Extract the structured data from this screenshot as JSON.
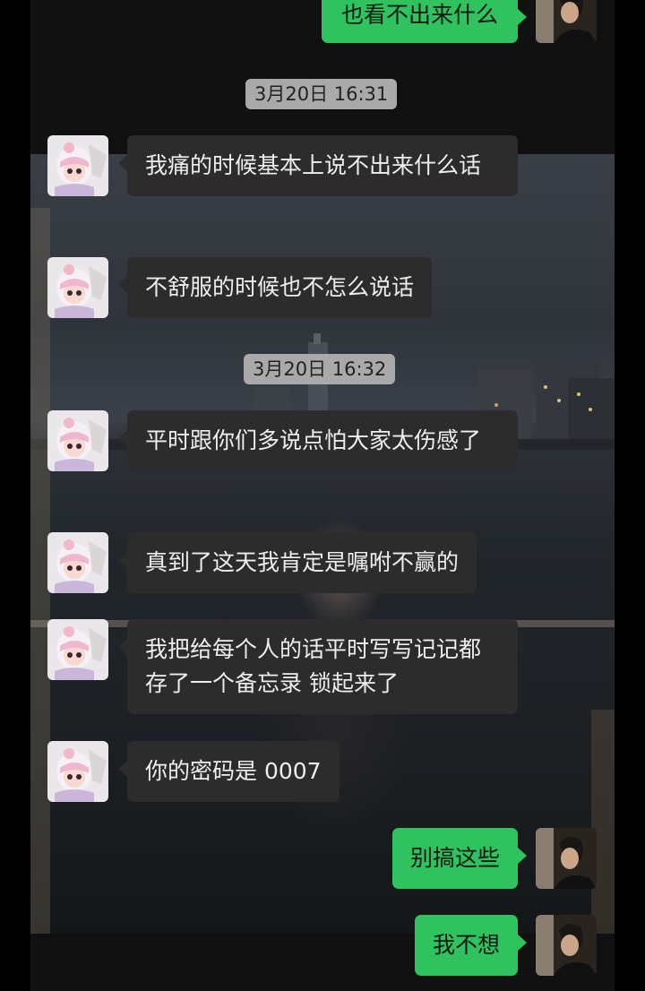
{
  "chat": {
    "timestamps": [
      "3月20日 16:31",
      "3月20日 16:32"
    ],
    "messages": [
      {
        "side": "right",
        "text": "也看不出来什么"
      },
      {
        "side": "left",
        "text": "我痛的时候基本上说不出来什么话"
      },
      {
        "side": "left",
        "text": "不舒服的时候也不怎么说话"
      },
      {
        "side": "left",
        "text": "平时跟你们多说点怕大家太伤感了"
      },
      {
        "side": "left",
        "text": "真到了这天我肯定是嘱咐不赢的"
      },
      {
        "side": "left",
        "text": "我把给每个人的话平时写写记记都存了一个备忘录 锁起来了"
      },
      {
        "side": "left",
        "text": "你的密码是 0007"
      },
      {
        "side": "right",
        "text": "别搞这些"
      },
      {
        "side": "right",
        "text": "我不想"
      }
    ]
  },
  "avatars": {
    "contact_icon": "cartoon-girl-avatar-icon",
    "self_icon": "man-portrait-avatar-icon"
  },
  "colors": {
    "sent_bubble": "#2fc25f",
    "received_bubble": "#2c2c2c",
    "timestamp_bg": "#a9a9a9"
  }
}
